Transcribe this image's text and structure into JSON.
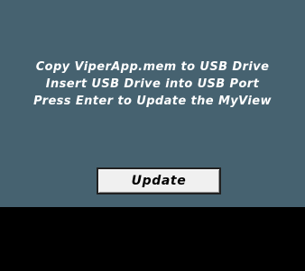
{
  "panel": {
    "background_color": "#466270",
    "instructions": [
      "Copy ViperApp.mem to USB Drive",
      "Insert USB Drive into USB Port",
      "Press Enter to Update the MyView"
    ],
    "update_button_label": "Update"
  },
  "colors": {
    "text": "#ffffff",
    "button_background": "#f0f0f0",
    "button_border": "#222222",
    "bottom_bar": "#000000"
  }
}
